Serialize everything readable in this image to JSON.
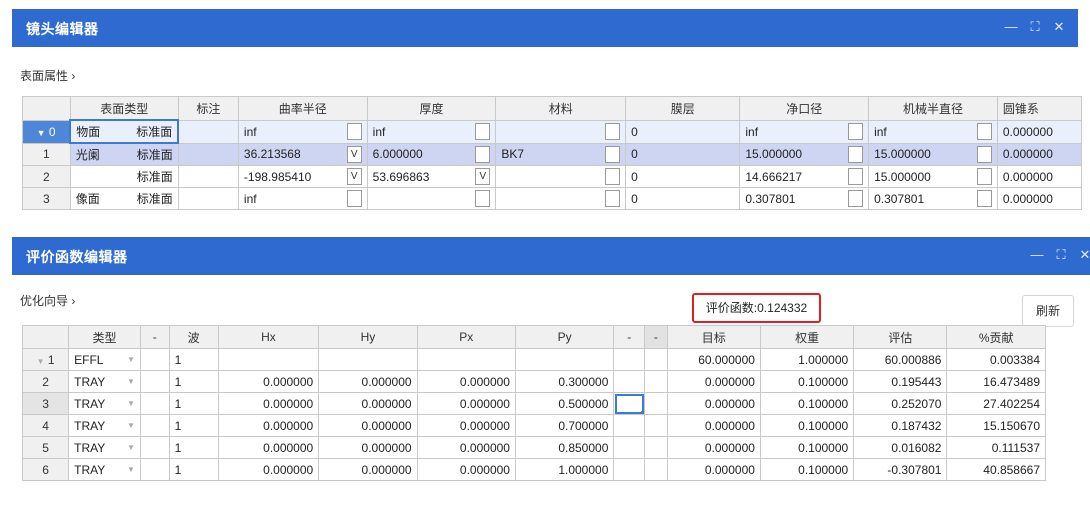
{
  "lens_editor": {
    "title": "镜头编辑器",
    "section": "表面属性 ›",
    "win_buttons": [
      "—",
      "⛶",
      "✕"
    ],
    "columns": [
      "表面类型",
      "标注",
      "曲率半径",
      "厚度",
      "材料",
      "膜层",
      "净口径",
      "机械半直径",
      "圆锥系"
    ],
    "rows": [
      {
        "idx": "0",
        "name": "物面",
        "type": "标准面",
        "comment": "",
        "radius": "inf",
        "rsolve": "",
        "thick": "inf",
        "tsolve": "",
        "mat": "",
        "coat": "0",
        "clear": "inf",
        "mech": "inf",
        "conic": "0.000000"
      },
      {
        "idx": "1",
        "name": "光阑",
        "type": "标准面",
        "comment": "",
        "radius": "36.213568",
        "rsolve": "V",
        "thick": "6.000000",
        "tsolve": "",
        "mat": "BK7",
        "coat": "0",
        "clear": "15.000000",
        "mech": "15.000000",
        "conic": "0.000000"
      },
      {
        "idx": "2",
        "name": "",
        "type": "标准面",
        "comment": "",
        "radius": "-198.985410",
        "rsolve": "V",
        "thick": "53.696863",
        "tsolve": "V",
        "mat": "",
        "coat": "0",
        "clear": "14.666217",
        "mech": "15.000000",
        "conic": "0.000000"
      },
      {
        "idx": "3",
        "name": "像面",
        "type": "标准面",
        "comment": "",
        "radius": "inf",
        "rsolve": "",
        "thick": "",
        "tsolve": "",
        "mat": "",
        "coat": "0",
        "clear": "0.307801",
        "mech": "0.307801",
        "conic": "0.000000"
      }
    ]
  },
  "merit_editor": {
    "title": "评价函数编辑器",
    "section": "优化向导 ›",
    "merit_label": "评价函数:0.124332",
    "refresh_label": "刷新",
    "win_buttons": [
      "—",
      "⛶",
      "✕"
    ],
    "columns": [
      "类型",
      "-",
      "波",
      "Hx",
      "Hy",
      "Px",
      "Py",
      "-",
      "-",
      "目标",
      "权重",
      "评估",
      "%贡献"
    ],
    "rows": [
      {
        "idx": "1",
        "type": "EFFL",
        "wave": "1",
        "hx": "",
        "hy": "",
        "px": "",
        "py": "",
        "target": "60.000000",
        "weight": "1.000000",
        "value": "60.000886",
        "contrib": "0.003384"
      },
      {
        "idx": "2",
        "type": "TRAY",
        "wave": "1",
        "hx": "0.000000",
        "hy": "0.000000",
        "px": "0.000000",
        "py": "0.300000",
        "target": "0.000000",
        "weight": "0.100000",
        "value": "0.195443",
        "contrib": "16.473489"
      },
      {
        "idx": "3",
        "type": "TRAY",
        "wave": "1",
        "hx": "0.000000",
        "hy": "0.000000",
        "px": "0.000000",
        "py": "0.500000",
        "target": "0.000000",
        "weight": "0.100000",
        "value": "0.252070",
        "contrib": "27.402254"
      },
      {
        "idx": "4",
        "type": "TRAY",
        "wave": "1",
        "hx": "0.000000",
        "hy": "0.000000",
        "px": "0.000000",
        "py": "0.700000",
        "target": "0.000000",
        "weight": "0.100000",
        "value": "0.187432",
        "contrib": "15.150670"
      },
      {
        "idx": "5",
        "type": "TRAY",
        "wave": "1",
        "hx": "0.000000",
        "hy": "0.000000",
        "px": "0.000000",
        "py": "0.850000",
        "target": "0.000000",
        "weight": "0.100000",
        "value": "0.016082",
        "contrib": "0.111537"
      },
      {
        "idx": "6",
        "type": "TRAY",
        "wave": "1",
        "hx": "0.000000",
        "hy": "0.000000",
        "px": "0.000000",
        "py": "1.000000",
        "target": "0.000000",
        "weight": "0.100000",
        "value": "-0.307801",
        "contrib": "40.858667"
      }
    ]
  }
}
